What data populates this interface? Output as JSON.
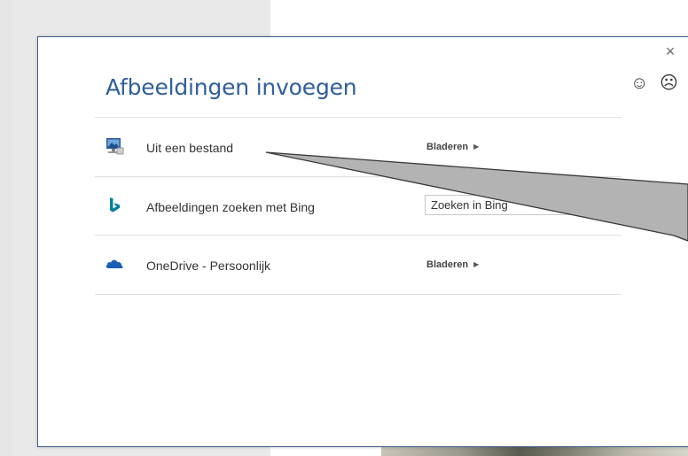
{
  "dialog": {
    "title": "Afbeeldingen invoegen",
    "close_glyph": "×",
    "feedback": {
      "smile_glyph": "☺",
      "frown_glyph": "☹"
    }
  },
  "sources": [
    {
      "icon": "computer-icon",
      "label": "Uit een bestand",
      "action_label": "Bladeren"
    },
    {
      "icon": "bing-icon",
      "label": "Afbeeldingen zoeken met Bing",
      "search_placeholder": "Zoeken in Bing"
    },
    {
      "icon": "onedrive-icon",
      "label": "OneDrive - Persoonlijk",
      "action_label": "Bladeren"
    }
  ],
  "colors": {
    "title": "#2f5f9b",
    "bing": "#00809d",
    "onedrive": "#1a5fb4",
    "dialog_border": "#3c5d87",
    "callout_fill": "#b3b3b3"
  }
}
